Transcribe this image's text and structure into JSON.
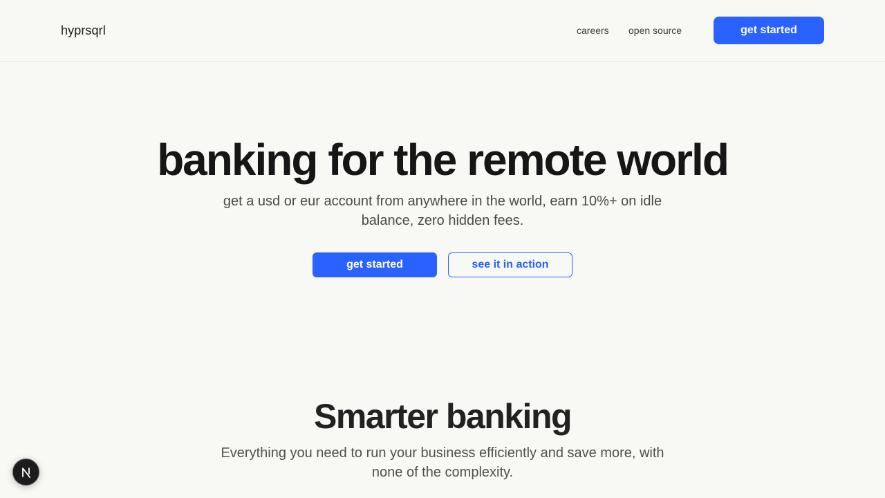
{
  "header": {
    "logo": "hyprsqrl",
    "nav": [
      {
        "label": "careers"
      },
      {
        "label": "open source"
      }
    ],
    "cta_label": "get started"
  },
  "hero": {
    "title": "banking for the remote world",
    "subtitle": "get a usd or eur account from anywhere in the world, earn 10%+ on idle balance, zero hidden fees.",
    "primary_label": "get started",
    "secondary_label": "see it in action"
  },
  "features": {
    "title": "Smarter banking",
    "subtitle": "Everything you need to run your business efficiently and save more, with none of the complexity."
  },
  "badge": {
    "icon": "nextjs-icon"
  },
  "colors": {
    "accent": "#2962ff",
    "background": "#f8f8f4",
    "text": "#161616"
  }
}
